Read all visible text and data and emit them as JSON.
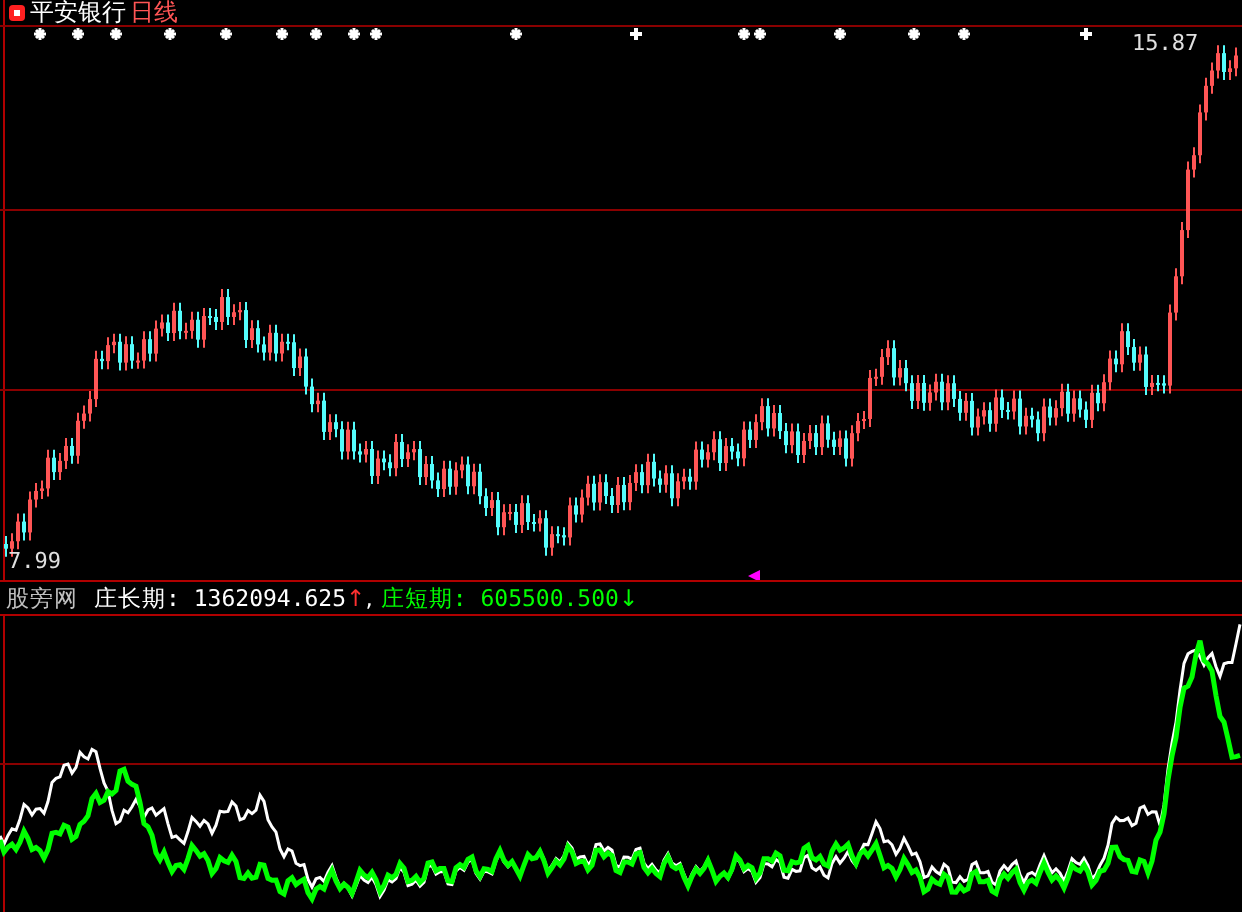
{
  "chart_header": {
    "stock_name": "平安银行",
    "period": "日线"
  },
  "price_labels": {
    "high": "15.87",
    "low": "7.99"
  },
  "indicator": {
    "name": "股旁网",
    "separator": ",",
    "lines": [
      {
        "label": "庄长期:",
        "value": "1362094.625",
        "arrow": "↑",
        "kind": "rising",
        "color": "#ffffff"
      },
      {
        "label": "庄短期:",
        "value": "605500.500",
        "arrow": "↓",
        "kind": "falling",
        "color": "#00ff00"
      }
    ]
  }
}
